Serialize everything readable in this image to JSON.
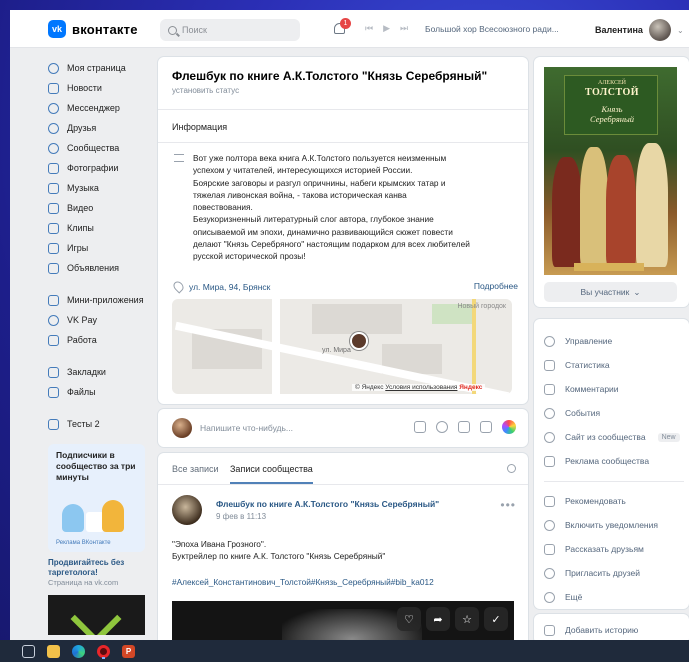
{
  "header": {
    "logo_mark": "vk",
    "logo_text": "вконтакте",
    "search_placeholder": "Поиск",
    "notification_count": "1",
    "player_prev": "⏮",
    "player_play": "▶",
    "player_next": "⏭",
    "track": "Большой хор Всесоюзного ради...",
    "user_name": "Валентина",
    "chevron": "⌄"
  },
  "sidebar": {
    "items": [
      {
        "label": "Моя страница",
        "icon": "user-circle-icon"
      },
      {
        "label": "Новости",
        "icon": "news-icon"
      },
      {
        "label": "Мессенджер",
        "icon": "message-icon"
      },
      {
        "label": "Друзья",
        "icon": "friends-icon"
      },
      {
        "label": "Сообщества",
        "icon": "communities-icon"
      },
      {
        "label": "Фотографии",
        "icon": "photo-icon"
      },
      {
        "label": "Музыка",
        "icon": "music-icon"
      },
      {
        "label": "Видео",
        "icon": "video-icon"
      },
      {
        "label": "Клипы",
        "icon": "clips-icon"
      },
      {
        "label": "Игры",
        "icon": "games-icon"
      },
      {
        "label": "Объявления",
        "icon": "ads-icon"
      },
      {
        "label": "Мини-приложения",
        "icon": "apps-icon"
      },
      {
        "label": "VK Pay",
        "icon": "vkpay-icon"
      },
      {
        "label": "Работа",
        "icon": "work-icon"
      },
      {
        "label": "Закладки",
        "icon": "bookmark-icon"
      },
      {
        "label": "Файлы",
        "icon": "files-icon"
      },
      {
        "label": "Тесты 2",
        "icon": "tests-icon"
      }
    ],
    "promo": {
      "title": "Подписчики в сообщество за три минуты",
      "brand": "Реклама ВКонтакте",
      "link": "Продвигайтесь без таргетолога!",
      "sub": "Страница на vk.com"
    }
  },
  "group": {
    "title": "Флешбук по книге А.К.Толстого \"Князь Серебряный\"",
    "set_status": "установить статус",
    "info_tab": "Информация",
    "description_lines": [
      "Вот уже полтора века книга А.К.Толстого пользуется неизменным",
      "успехом у читателей, интересующихся историей России.",
      "Боярские заговоры и разгул опричнины, набеги крымских татар и",
      "тяжелая ливонская война, - такова историческая канва",
      "повествования.",
      "Безукоризненный литературный слог автора, глубокое знание",
      "описываемой им эпохи, динамично развивающийся сюжет повести",
      "делают \"Князь Серебряного\" настоящим подарком для всех любителей",
      "русской исторической прозы!"
    ],
    "address": "ул. Мира, 94, Брянск",
    "more": "Подробнее",
    "map": {
      "label_top": "Новый городок",
      "street": "ул. Мира",
      "footer_copy": "© Яндекс",
      "footer_terms": "Условия использования",
      "footer_brand": "Яндекс"
    }
  },
  "compose": {
    "placeholder": "Напишите что-нибудь..."
  },
  "feed": {
    "tab_all": "Все записи",
    "tab_community": "Записи сообщества",
    "post": {
      "author": "Флешбук по книге А.К.Толстого \"Князь Серебряный\"",
      "date": "9 фев в 11:13",
      "dots": "•••",
      "text_line1": "\"Эпоха Ивана Грозного\".",
      "text_line2": "Буктрейлер по книге А.К. Толстого \"Князь Серебряный\"",
      "tags": "#Алексей_Константинович_Толстой#Князь_Серебряный#bib_ka012"
    },
    "media_actions": [
      "♡",
      "➦",
      "☆",
      "✓"
    ]
  },
  "cover": {
    "author": "АЛЕКСЕЙ",
    "surname": "ТОЛСТОЙ",
    "title_line1": "Князь",
    "title_line2": "Серебряный"
  },
  "right": {
    "participant": "Вы участник",
    "participant_chevron": "⌄",
    "menu_group1": [
      {
        "label": "Управление",
        "icon": "gear-icon"
      },
      {
        "label": "Статистика",
        "icon": "stats-icon"
      },
      {
        "label": "Комментарии",
        "icon": "comments-icon"
      },
      {
        "label": "События",
        "icon": "events-icon"
      },
      {
        "label": "Сайт из сообщества",
        "icon": "globe-icon",
        "badge": "New"
      },
      {
        "label": "Реклама сообщества",
        "icon": "megaphone-icon"
      }
    ],
    "menu_group2": [
      {
        "label": "Рекомендовать",
        "icon": "thumbs-up-icon"
      },
      {
        "label": "Включить уведомления",
        "icon": "bell-icon"
      },
      {
        "label": "Рассказать друзьям",
        "icon": "share-icon"
      },
      {
        "label": "Пригласить друзей",
        "icon": "invite-icon"
      },
      {
        "label": "Ещё",
        "icon": "chevron-down-icon"
      }
    ],
    "story": "Добавить историю"
  },
  "taskbar": {
    "ppt_label": "P"
  },
  "colors": {
    "accent": "#0077ff",
    "link": "#2a5885",
    "background": "#edeef0",
    "desktop": "#2b2fb6"
  }
}
